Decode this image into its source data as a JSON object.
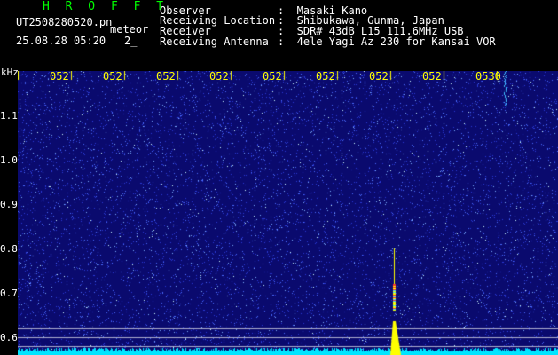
{
  "header": {
    "app_title": "H R O F F T",
    "filename": "UT2508280520.pn",
    "meteor_label": "meteor",
    "datetime": "25.08.28 05:20",
    "count": "2_"
  },
  "info": [
    {
      "label": "Observer",
      "value": ":  Masaki Kano"
    },
    {
      "label": "Receiving Location",
      "value": ":  Shibukawa, Gunma, Japan"
    },
    {
      "label": "Receiver",
      "value": ":  SDR# 43dB L15 111.6MHz USB"
    },
    {
      "label": "Receiving Antenna",
      "value": ":  4ele Yagi Az 230 for Kansai VOR"
    }
  ],
  "axis": {
    "unit": "kHz",
    "y_ticks": [
      "1.1",
      "1.0",
      "0.9",
      "0.8",
      "0.7",
      "0.6"
    ],
    "x_ticks": [
      "052",
      "052",
      "052",
      "052",
      "052",
      "052",
      "052",
      "052",
      "0530"
    ]
  },
  "colors": {
    "background": "#000000",
    "spectrogram_bg": "#0a0a6e",
    "tick_color": "#ffff00",
    "title_color": "#00ff00",
    "meteor_trail": "#ffff00",
    "noise_floor": "#00e5ff"
  }
}
